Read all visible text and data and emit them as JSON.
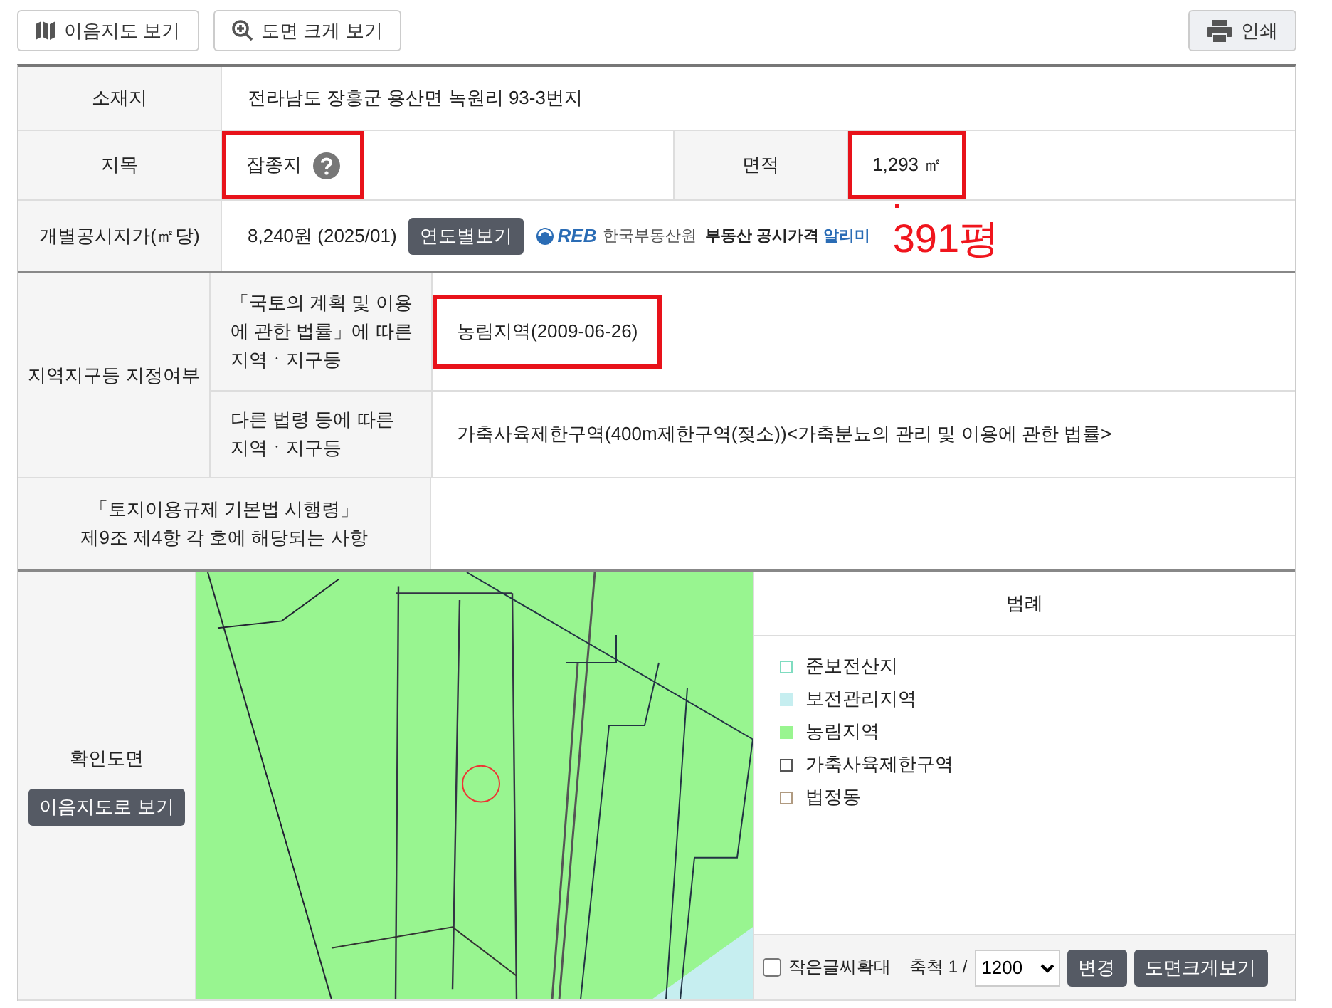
{
  "toolbar": {
    "buttons": [
      {
        "label": "이음지도 보기",
        "kind": "map"
      },
      {
        "label": "도면 크게 보기",
        "kind": "zoom"
      }
    ],
    "print": {
      "label": "인쇄"
    }
  },
  "info": {
    "location": {
      "label": "소재지",
      "value": "전라남도 장흥군 용산면 녹원리 93-3번지"
    },
    "land_category": {
      "label": "지목",
      "value": "잡종지",
      "highlighted": true
    },
    "area": {
      "label": "면적",
      "value": "1,293 ㎡",
      "highlighted": true
    },
    "price": {
      "label": "개별공시지가(㎡당)",
      "value": "8,240원 (2025/01)",
      "button": "연도별보기",
      "logo_mark": "REB",
      "logo_org": "한국부동산원",
      "logo_service": "부동산 공시가격",
      "logo_service_accent": "알리미"
    },
    "annotation": "391평"
  },
  "zoning": {
    "label": "지역지구등 지정여부",
    "rows": [
      {
        "label": "「국토의 계획 및 이용에 관한 법률」에 따른 지역ㆍ지구등",
        "value": "농림지역(2009-06-26)",
        "highlighted": true
      },
      {
        "label": "다른 법령 등에 따른 지역ㆍ지구등",
        "value": "가축사육제한구역(400m제한구역(젖소))<가축분뇨의 관리 및 이용에 관한 법률>",
        "highlighted": false
      }
    ],
    "decree": {
      "label_lines": [
        "「토지이용규제 기본법 시행령」",
        "제9조 제4항 각 호에 해당되는 사항"
      ]
    }
  },
  "map": {
    "label": "확인도면",
    "button": "이음지도로 보기",
    "kind": "picture",
    "legend": {
      "title": "범례",
      "items": [
        {
          "label": "준보전산지",
          "kind": "outline",
          "color": "#7fdcc0"
        },
        {
          "label": "보전관리지역",
          "kind": "filled",
          "color": "#c6eef0"
        },
        {
          "label": "농림지역",
          "kind": "filled",
          "color": "#99f590"
        },
        {
          "label": "가축사육제한구역",
          "kind": "outline",
          "color": "#555555"
        },
        {
          "label": "법정동",
          "kind": "outline",
          "color": "#b09a80"
        }
      ]
    },
    "controls": {
      "small_text": {
        "label": "작은글씨확대",
        "checked": false
      },
      "scale_label": "축척 1 /",
      "scale": "1200",
      "apply": "변경",
      "enlarge": "도면크게보기"
    }
  }
}
